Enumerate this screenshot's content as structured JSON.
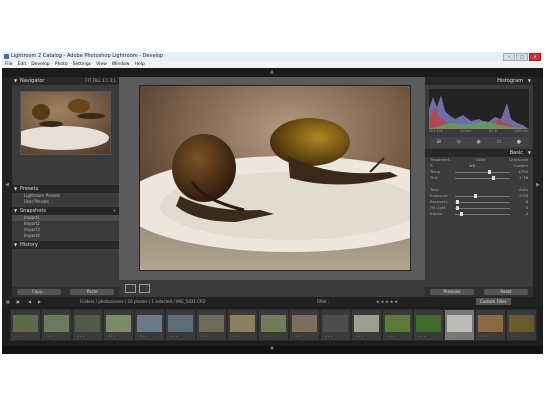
{
  "window": {
    "title": "Lightroom 2 Catalog - Adobe Photoshop Lightroom - Develop",
    "controls": [
      "–",
      "□",
      "×"
    ]
  },
  "menu": [
    "File",
    "Edit",
    "Develop",
    "Photo",
    "Settings",
    "View",
    "Window",
    "Help"
  ],
  "left_panel": {
    "navigator_title": "Navigator",
    "navigator_zoom": [
      "FIT",
      "FILL",
      "1:1",
      "3:1"
    ],
    "presets_title": "Presets",
    "presets": [
      "Lightroom Presets",
      "User Presets"
    ],
    "snapshots_title": "Snapshots",
    "snapshots": [
      "Import1",
      "Import2",
      "Import3",
      "Import4"
    ],
    "history_title": "History",
    "copy_label": "Copy...",
    "paste_label": "Paste"
  },
  "right_panel": {
    "histogram_title": "Histogram",
    "histogram_readout": [
      "ISO 400",
      "35mm",
      "f/2.8",
      "1/60 sec"
    ],
    "basic_title": "Basic",
    "treatment_label": "Treatment :",
    "treatment_options": [
      "Color",
      "Grayscale"
    ],
    "wb_label": "WB :",
    "wb_value": "Custom",
    "temp_label": "Temp",
    "temp_value": "4750",
    "tint_label": "Tint",
    "tint_value": "+ 16",
    "tone_label": "Tone",
    "auto_label": "Auto",
    "exposure_label": "Exposure",
    "exposure_value": "0.00",
    "recovery_label": "Recovery",
    "recovery_value": "0",
    "fill_label": "Fill Light",
    "fill_value": "0",
    "blacks_label": "Blacks",
    "blacks_value": "5",
    "previous_label": "Previous",
    "reset_label": "Reset"
  },
  "filmstrip_bar": {
    "path": "Folders / photoscenes / 16 photos / 1 selected / IMG_5831.CR2",
    "filter_label": "Filter :",
    "custom_filter": "Custom Filter"
  },
  "filmstrip": {
    "thumb_colors": [
      "#5a6a4a",
      "#6b7a5c",
      "#4f5a48",
      "#7a8a6a",
      "#6a7b87",
      "#5d6d78",
      "#6e6a5a",
      "#8a8060",
      "#6f7c57",
      "#7d6d5a",
      "#4d4d52",
      "#9aa08a",
      "#5a7a3a",
      "#3e6a2e",
      "#bdbdb8",
      "#8a6a44",
      "#6a5a2a"
    ]
  }
}
